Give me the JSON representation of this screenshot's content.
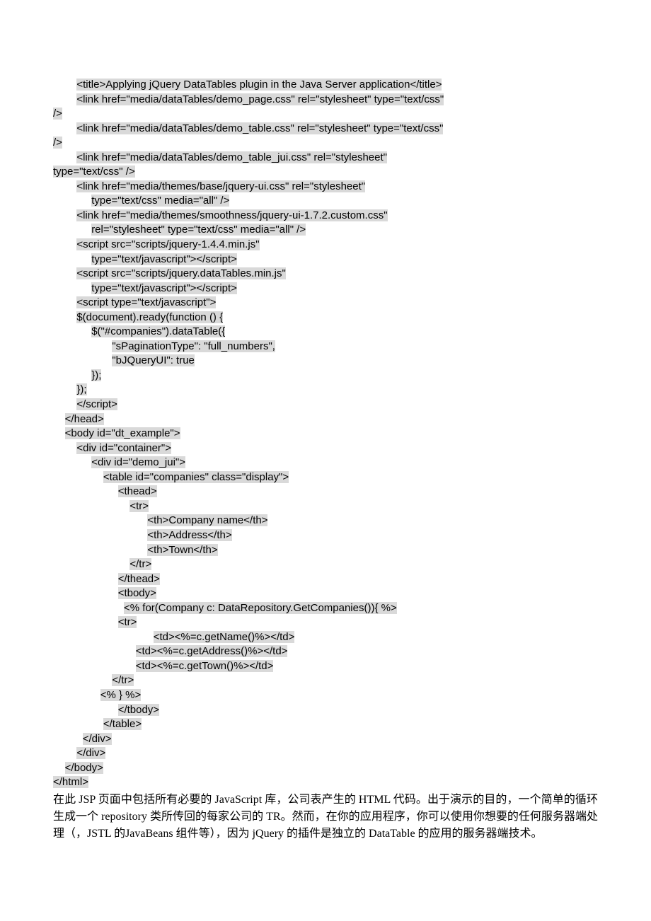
{
  "code_lines": [
    {
      "indent": "        ",
      "text": "<title>Applying jQuery DataTables plugin in the Java Server application</title>"
    },
    {
      "indent": "        ",
      "text": "<link href=\"media/dataTables/demo_page.css\" rel=\"stylesheet\" type=\"text/css\""
    },
    {
      "indent": "",
      "text": "/>"
    },
    {
      "indent": "        ",
      "text": "<link href=\"media/dataTables/demo_table.css\" rel=\"stylesheet\" type=\"text/css\""
    },
    {
      "indent": "",
      "text": "/>"
    },
    {
      "indent": "        ",
      "text": "<link href=\"media/dataTables/demo_table_jui.css\" rel=\"stylesheet\""
    },
    {
      "indent": "",
      "text": "type=\"text/css\" />"
    },
    {
      "indent": "        ",
      "text": "<link href=\"media/themes/base/jquery-ui.css\" rel=\"stylesheet\""
    },
    {
      "indent": "             ",
      "text": "type=\"text/css\" media=\"all\" />"
    },
    {
      "indent": "        ",
      "text": "<link href=\"media/themes/smoothness/jquery-ui-1.7.2.custom.css\""
    },
    {
      "indent": "             ",
      "text": "rel=\"stylesheet\" type=\"text/css\" media=\"all\" />"
    },
    {
      "indent": "        ",
      "text": "<script src=\"scripts/jquery-1.4.4.min.js\""
    },
    {
      "indent": "             ",
      "text": "type=\"text/javascript\"></script>"
    },
    {
      "indent": "        ",
      "text": "<script src=\"scripts/jquery.dataTables.min.js\""
    },
    {
      "indent": "             ",
      "text": "type=\"text/javascript\"></script>"
    },
    {
      "indent": "        ",
      "text": "<script type=\"text/javascript\">"
    },
    {
      "indent": "        ",
      "text": "$(document).ready(function () {"
    },
    {
      "indent": "             ",
      "text": "$(\"#companies\").dataTable({"
    },
    {
      "indent": "                    ",
      "text": "\"sPaginationType\": \"full_numbers\","
    },
    {
      "indent": "                    ",
      "text": "\"bJQueryUI\": true"
    },
    {
      "indent": "             ",
      "text": "});"
    },
    {
      "indent": "        ",
      "text": "});"
    },
    {
      "indent": "        ",
      "text": "</script>"
    },
    {
      "indent": "    ",
      "text": "</head>"
    },
    {
      "indent": "    ",
      "text": "<body id=\"dt_example\">"
    },
    {
      "indent": "        ",
      "text": "<div id=\"container\">"
    },
    {
      "indent": "             ",
      "text": "<div id=\"demo_jui\">"
    },
    {
      "indent": "                 ",
      "text": "<table id=\"companies\" class=\"display\">"
    },
    {
      "indent": "                      ",
      "text": "<thead>"
    },
    {
      "indent": "                          ",
      "text": "<tr>"
    },
    {
      "indent": "                                ",
      "text": "<th>Company name</th>"
    },
    {
      "indent": "                                ",
      "text": "<th>Address</th>"
    },
    {
      "indent": "                                ",
      "text": "<th>Town</th>"
    },
    {
      "indent": "                          ",
      "text": "</tr>"
    },
    {
      "indent": "                      ",
      "text": "</thead>"
    },
    {
      "indent": "                      ",
      "text": "<tbody>"
    },
    {
      "indent": "                        ",
      "text": "<% for(Company c: DataRepository.GetCompanies()){ %>"
    },
    {
      "indent": "                      ",
      "text": "<tr>"
    },
    {
      "indent": "                                  ",
      "text": "<td><%=c.getName()%></td>"
    },
    {
      "indent": "                            ",
      "text": "<td><%=c.getAddress()%></td>"
    },
    {
      "indent": "                            ",
      "text": "<td><%=c.getTown()%></td>"
    },
    {
      "indent": "                    ",
      "text": "</tr>"
    },
    {
      "indent": "                ",
      "text": "<% } %>"
    },
    {
      "indent": "                      ",
      "text": "</tbody>"
    },
    {
      "indent": "                 ",
      "text": "</table>"
    },
    {
      "indent": "          ",
      "text": "</div>"
    },
    {
      "indent": "        ",
      "text": "</div>"
    },
    {
      "indent": "    ",
      "text": "</body>"
    },
    {
      "indent": "",
      "text": "</html>"
    }
  ],
  "paragraph": "在此 JSP 页面中包括所有必要的 JavaScript 库，公司表产生的 HTML 代码。出于演示的目的，一个简单的循环生成一个 repository 类所传回的每家公司的 TR。然而，在你的应用程序，你可以使用你想要的任何服务器端处理（，JSTL 的JavaBeans 组件等），因为 jQuery 的插件是独立的 DataTable 的应用的服务器端技术。"
}
